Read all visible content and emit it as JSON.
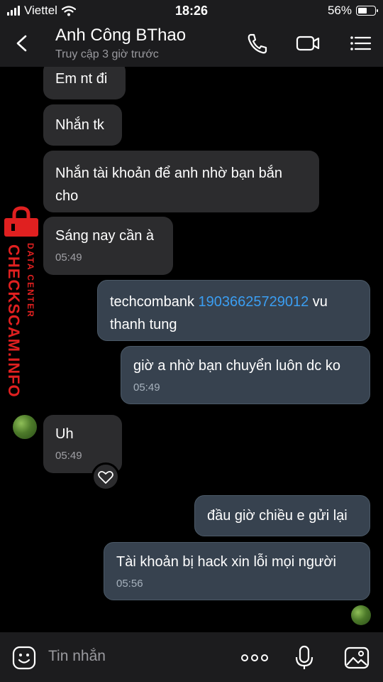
{
  "status_bar": {
    "carrier": "Viettel",
    "time": "18:26",
    "battery": "56%",
    "battery_level": 0.56
  },
  "header": {
    "contact_name": "Anh Công BThao",
    "last_seen": "Truy cập 3 giờ trước",
    "icons": [
      "back-icon",
      "phone-icon",
      "video-call-icon",
      "menu-icon"
    ]
  },
  "watermark": {
    "main": "CHECKSCAM.INFO",
    "sub": "DATA CENTER"
  },
  "messages": [
    {
      "side": "in",
      "text": "Em nt đi"
    },
    {
      "side": "in",
      "text": "Nhắn tk"
    },
    {
      "side": "in",
      "text_line1": "Nhắn tài khoản để anh nhờ bạn bắn",
      "text_line2": "cho"
    },
    {
      "side": "in",
      "text": "Sáng nay cần à",
      "time": "05:49"
    },
    {
      "side": "out",
      "text_pre": "techcombank ",
      "account": "19036625729012",
      "text_post": " vu thanh tung"
    },
    {
      "side": "out",
      "text": "giờ a nhờ bạn chuyển luôn dc ko",
      "time": "05:49"
    },
    {
      "side": "in",
      "text": "Uh",
      "time": "05:49",
      "reaction": "heart-icon"
    },
    {
      "side": "out",
      "text": "đầu giờ chiều e gửi lại"
    },
    {
      "side": "out",
      "text": "Tài khoản bị hack  xin lỗi mọi người",
      "time": "05:56"
    }
  ],
  "composer": {
    "placeholder": "Tin nhắn",
    "icons": [
      "sticker-icon",
      "more-icon",
      "microphone-icon",
      "image-icon"
    ]
  },
  "colors": {
    "background": "#000000",
    "bar": "#1c1c1e",
    "incoming_bubble": "#2c2c2e",
    "outgoing_bubble": "#37424f",
    "link": "#3b9ef2",
    "watermark": "#e02020"
  }
}
